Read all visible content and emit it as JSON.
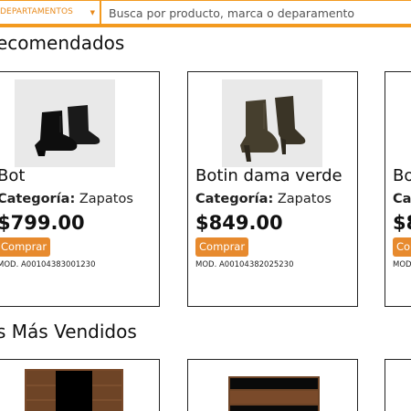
{
  "header": {
    "departments_label": "DEPARTAMENTOS",
    "search_placeholder": "Busca por producto, marca o deparamento"
  },
  "recommended": {
    "title": "ecomendados",
    "products": [
      {
        "name": "Bot",
        "category_label": "Categoría:",
        "category": "Zapatos",
        "price": "$799.00",
        "button": "Comprar",
        "model": "MOD. A00104383001230",
        "image": "black-ankle-boot"
      },
      {
        "name": "Botin dama verde",
        "category_label": "Categoría:",
        "category": "Zapatos",
        "price": "$849.00",
        "button": "Comprar",
        "model": "MOD. A00104382025230",
        "image": "green-ankle-boot"
      },
      {
        "name": "Bo",
        "category_label": "Cat",
        "price": "$8",
        "button": "Com",
        "model": "MOD"
      }
    ]
  },
  "best_sellers": {
    "title": "s Más Vendidos",
    "products": [
      {
        "image": "wood-cabinet"
      },
      {
        "image": "wood-shelf"
      }
    ]
  },
  "colors": {
    "accent": "#f39a1f",
    "button": "#e78a2e"
  }
}
